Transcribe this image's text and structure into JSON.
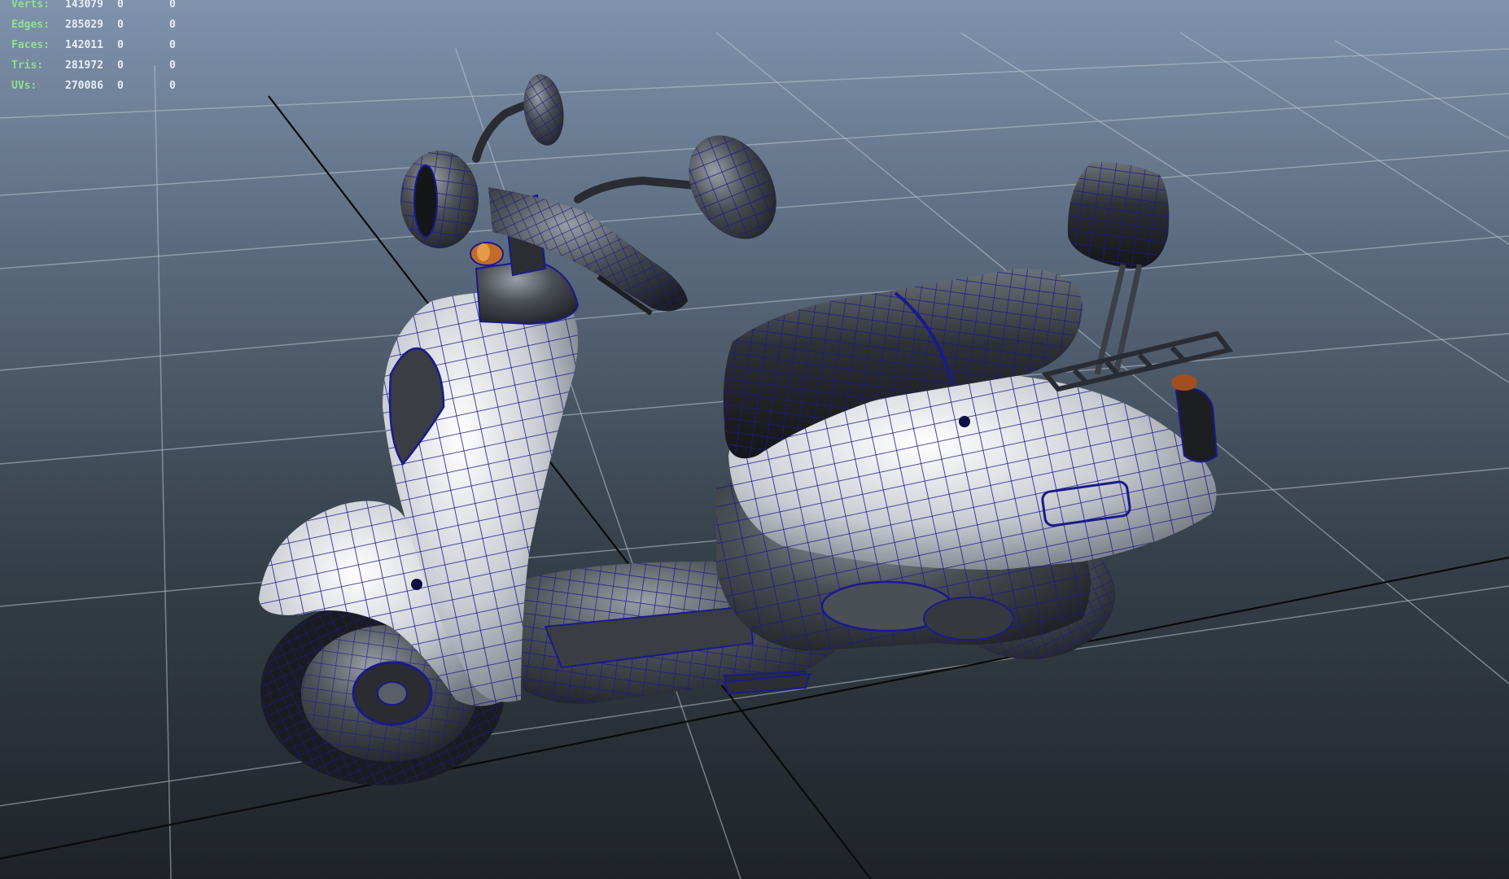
{
  "heads_up_display": {
    "rows": [
      {
        "label": "Verts:",
        "total": "143079",
        "selected": "0",
        "component": "0"
      },
      {
        "label": "Edges:",
        "total": "285029",
        "selected": "0",
        "component": "0"
      },
      {
        "label": "Faces:",
        "total": "142011",
        "selected": "0",
        "component": "0"
      },
      {
        "label": "Tris:",
        "total": "281972",
        "selected": "0",
        "component": "0"
      },
      {
        "label": "UVs:",
        "total": "270086",
        "selected": "0",
        "component": "0"
      }
    ]
  },
  "colors": {
    "hud_label": "#8fe08f",
    "hud_value": "#e9edf2",
    "wireframe": "#1a1a8c",
    "grid": "#b8c2cc"
  },
  "icons": [
    "scooter-model",
    "ground-grid",
    "world-axis"
  ]
}
